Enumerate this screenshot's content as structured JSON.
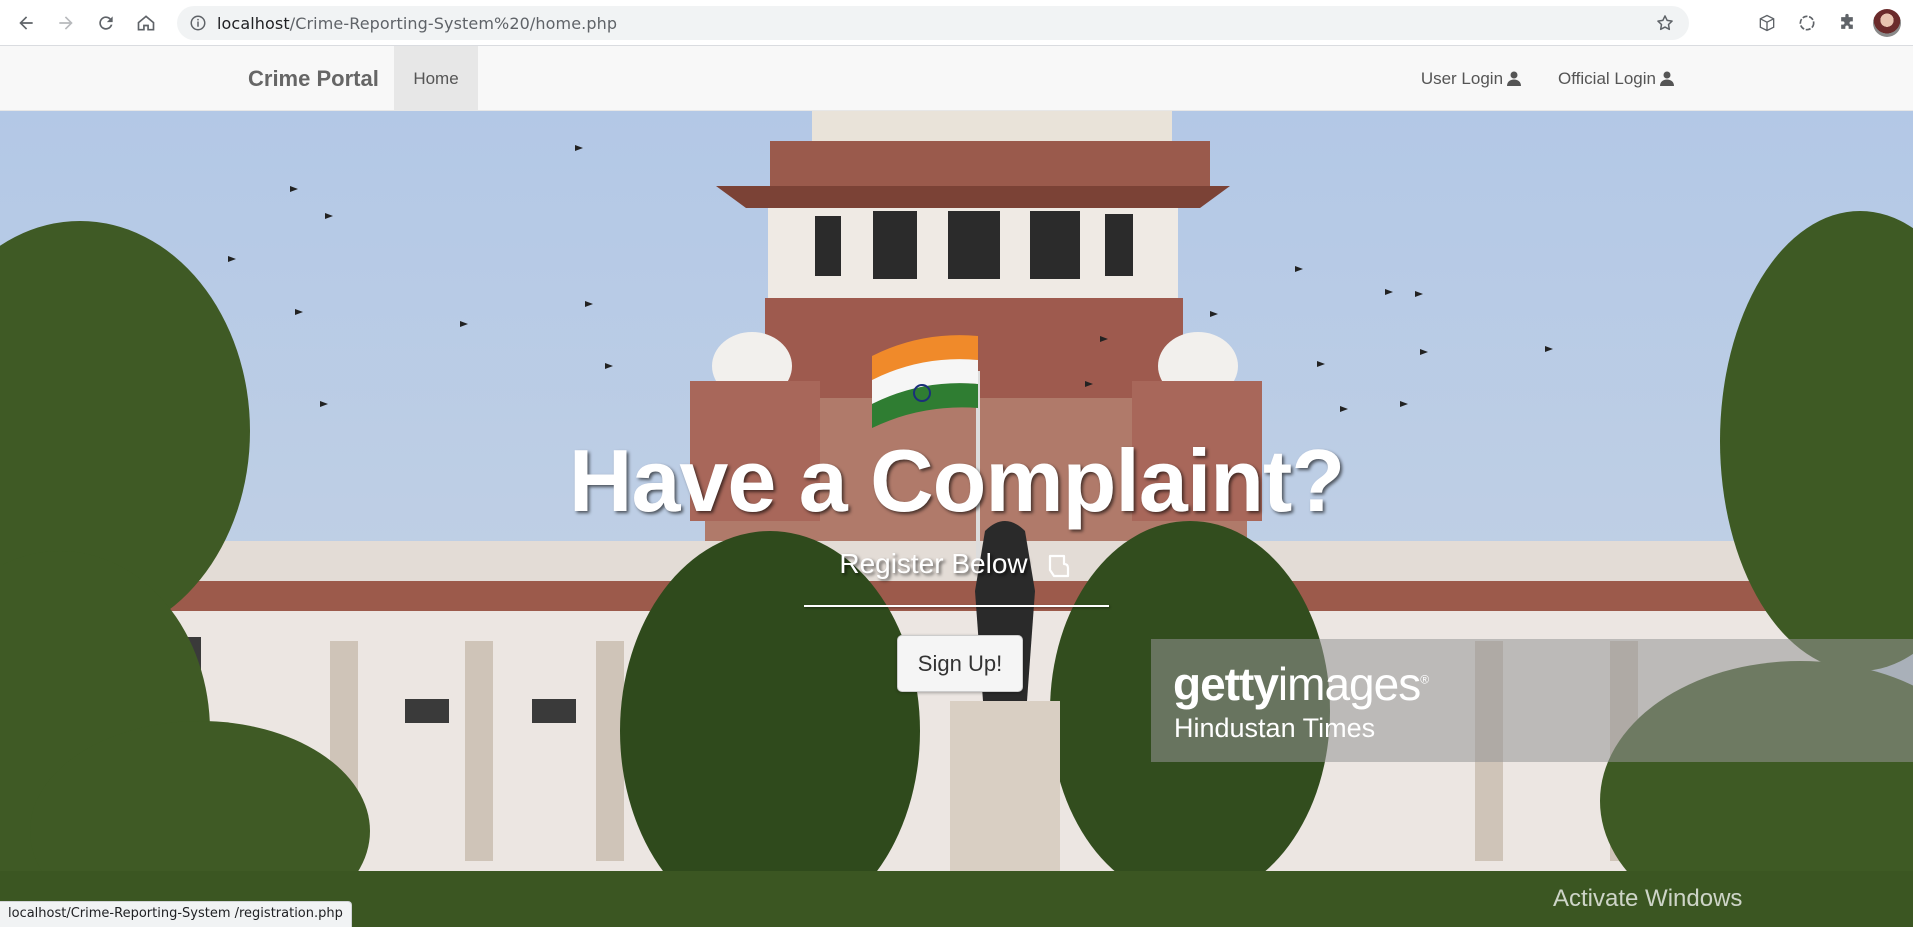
{
  "browser": {
    "url_host": "localhost",
    "url_path": "/Crime-Reporting-System%20/home.php",
    "status_url": "localhost/Crime-Reporting-System /registration.php"
  },
  "navbar": {
    "brand": "Crime Portal",
    "home": "Home",
    "user_login": "User Login",
    "official_login": "Official Login"
  },
  "hero": {
    "title": "Have a Complaint?",
    "subtitle": "Register Below",
    "signup": "Sign Up!"
  },
  "watermark": {
    "logo_bold": "getty",
    "logo_light": "images",
    "logo_mark": "®",
    "credit": "Hindustan Times"
  },
  "os_overlay": {
    "activate": "Activate Windows"
  },
  "colors": {
    "navbar_bg": "#f8f8f8",
    "home_active_bg": "#e7e7e7",
    "hero_text": "#ffffff"
  }
}
